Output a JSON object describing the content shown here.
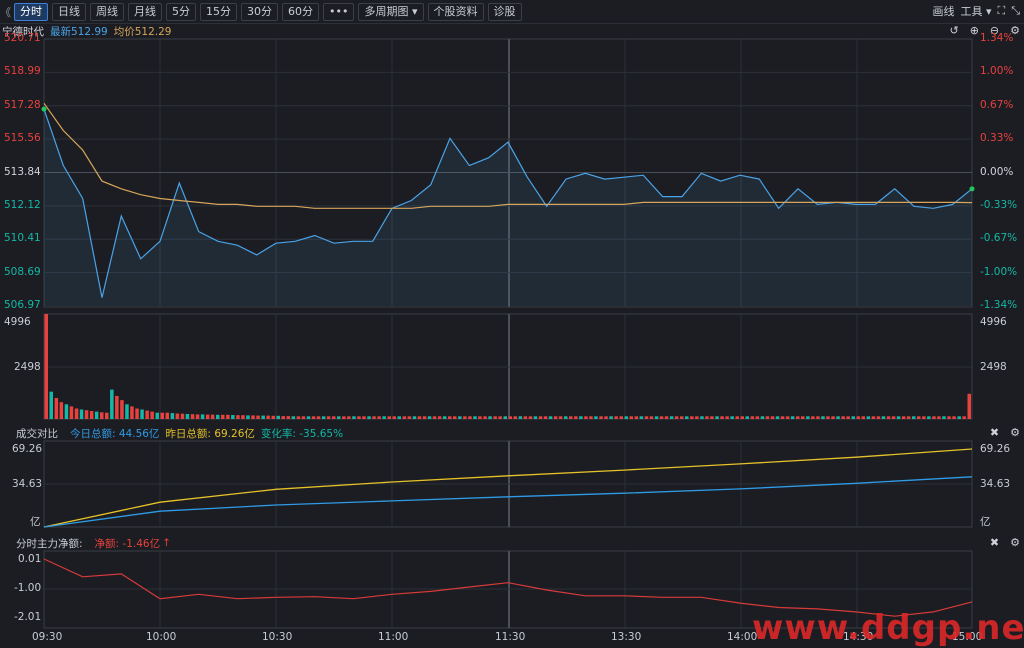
{
  "toolbar": {
    "left_arrow": "《",
    "tabs": [
      {
        "label": "分时",
        "active": true
      },
      {
        "label": "日线",
        "active": false
      },
      {
        "label": "周线",
        "active": false
      },
      {
        "label": "月线",
        "active": false
      },
      {
        "label": "5分",
        "active": false
      },
      {
        "label": "15分",
        "active": false
      },
      {
        "label": "30分",
        "active": false
      },
      {
        "label": "60分",
        "active": false
      }
    ],
    "more_label": "•••",
    "multi_period_label": "多周期图",
    "stock_info_label": "个股资料",
    "diagnose_label": "诊股",
    "draw_label": "画线",
    "tools_label": "工具"
  },
  "price_panel": {
    "stock_name": "宁德时代",
    "latest_label": "最新512.99",
    "avg_label": "均价512.29",
    "y_left": [
      "520.71",
      "518.99",
      "517.28",
      "515.56",
      "513.84",
      "512.12",
      "510.41",
      "508.69",
      "506.97"
    ],
    "y_right": [
      "1.34%",
      "1.00%",
      "0.67%",
      "0.33%",
      "0.00%",
      "-0.33%",
      "-0.67%",
      "-1.00%",
      "-1.34%"
    ]
  },
  "volume_panel": {
    "y_left": [
      "4996",
      "2498"
    ],
    "y_right": [
      "4996",
      "2498"
    ]
  },
  "compare_panel": {
    "title": "成交对比",
    "today_label": "今日总额: 44.56亿",
    "yesterday_label": "昨日总额: 69.26亿",
    "change_label": "变化率: -35.65%",
    "y_left": [
      "69.26",
      "34.63",
      "亿"
    ],
    "y_right": [
      "69.26",
      "34.63",
      "亿"
    ]
  },
  "flow_panel": {
    "title": "分时主力净额:",
    "net_label": "净额: -1.46亿",
    "y_left": [
      "0.01",
      "-1.00",
      "-2.01"
    ]
  },
  "x_labels": [
    "09:30",
    "10:00",
    "10:30",
    "11:00",
    "11:30",
    "13:30",
    "14:00",
    "14:30",
    "15:00"
  ],
  "watermark": "www.ddgp.net",
  "colors": {
    "price_line": "#4aa3e8",
    "avg_line": "#d6a55a",
    "up": "#e8413e",
    "down": "#14b8a6",
    "today_line": "#2f9be6",
    "yesterday_line": "#e6c229",
    "flow_line": "#d83a3a",
    "grid": "#2c3038",
    "accent": "#3d7fd6"
  },
  "chart_data": [
    {
      "type": "line",
      "name": "price",
      "x": [
        "09:30",
        "09:35",
        "09:40",
        "09:45",
        "09:50",
        "09:55",
        "10:00",
        "10:05",
        "10:10",
        "10:15",
        "10:20",
        "10:25",
        "10:30",
        "10:35",
        "10:40",
        "10:45",
        "10:50",
        "10:55",
        "11:00",
        "11:05",
        "11:10",
        "11:15",
        "11:20",
        "11:25",
        "11:30",
        "13:05",
        "13:10",
        "13:15",
        "13:20",
        "13:25",
        "13:30",
        "13:35",
        "13:40",
        "13:45",
        "13:50",
        "13:55",
        "14:00",
        "14:05",
        "14:10",
        "14:15",
        "14:20",
        "14:25",
        "14:30",
        "14:35",
        "14:40",
        "14:45",
        "14:50",
        "14:55",
        "15:00"
      ],
      "series": [
        {
          "values": [
            517.1,
            514.2,
            512.5,
            507.4,
            511.6,
            509.4,
            510.3,
            513.3,
            510.8,
            510.3,
            510.1,
            509.6,
            510.2,
            510.3,
            510.6,
            510.2,
            510.3,
            510.3,
            512.0,
            512.4,
            513.2,
            515.6,
            514.2,
            514.6,
            515.4,
            513.6,
            512.1,
            513.5,
            513.8,
            513.5,
            513.6,
            513.7,
            512.6,
            512.6,
            513.8,
            513.4,
            513.7,
            513.5,
            512.0,
            513.0,
            512.2,
            512.3,
            512.2,
            512.2,
            513.0,
            512.1,
            512.0,
            512.2,
            513.0
          ]
        },
        {
          "values": [
            517.4,
            516.0,
            515.0,
            513.4,
            513.0,
            512.7,
            512.5,
            512.4,
            512.3,
            512.2,
            512.2,
            512.1,
            512.1,
            512.1,
            512.0,
            512.0,
            512.0,
            512.0,
            512.0,
            512.0,
            512.1,
            512.1,
            512.1,
            512.1,
            512.2,
            512.2,
            512.2,
            512.2,
            512.2,
            512.2,
            512.2,
            512.3,
            512.3,
            512.3,
            512.3,
            512.3,
            512.3,
            512.3,
            512.3,
            512.3,
            512.3,
            512.3,
            512.3,
            512.3,
            512.3,
            512.3,
            512.3,
            512.3,
            512.29
          ]
        }
      ],
      "ylim": [
        506.97,
        520.71
      ]
    },
    {
      "type": "bar",
      "name": "volume",
      "values": [
        4996,
        1300,
        1000,
        800,
        700,
        600,
        500,
        450,
        420,
        380,
        350,
        320,
        300,
        1400,
        1100,
        900,
        700,
        600,
        500,
        450,
        400,
        350,
        300,
        300,
        300,
        280,
        260,
        250,
        240,
        230,
        220,
        220,
        210,
        210,
        200,
        200,
        200,
        190,
        180,
        180,
        170,
        170,
        160,
        160,
        160,
        150,
        150,
        140,
        140,
        130,
        130,
        130,
        130,
        130,
        130,
        130,
        130,
        130,
        130,
        130,
        130,
        130,
        130,
        130,
        130,
        130,
        130,
        130,
        130,
        130,
        130,
        130,
        130,
        130,
        130,
        130,
        130,
        130,
        130,
        130,
        130,
        130,
        130,
        130,
        130,
        130,
        130,
        130,
        130,
        130,
        130,
        130,
        130,
        130,
        130,
        130,
        130,
        130,
        130,
        130,
        130,
        130,
        130,
        130,
        130,
        130,
        130,
        130,
        130,
        130,
        130,
        130,
        130,
        130,
        130,
        130,
        130,
        130,
        130,
        130,
        130,
        130,
        130,
        130,
        130,
        130,
        130,
        130,
        130,
        130,
        130,
        130,
        130,
        130,
        130,
        130,
        130,
        130,
        130,
        130,
        130,
        130,
        130,
        130,
        130,
        130,
        130,
        130,
        130,
        130,
        130,
        130,
        130,
        130,
        130,
        130,
        130,
        130,
        130,
        130,
        130,
        130,
        130,
        130,
        130,
        130,
        130,
        130,
        130,
        130,
        130,
        130,
        130,
        130,
        130,
        130,
        130,
        130,
        130,
        130,
        130,
        130,
        130,
        1200
      ],
      "ylim": [
        0,
        4996
      ]
    },
    {
      "type": "line",
      "name": "compare",
      "x": [
        "09:30",
        "10:00",
        "10:30",
        "11:00",
        "11:30",
        "13:30",
        "14:00",
        "14:30",
        "15:00"
      ],
      "series": [
        {
          "values": [
            0,
            14.0,
            19.5,
            23.2,
            26.8,
            30.0,
            33.8,
            38.8,
            44.56
          ]
        },
        {
          "values": [
            0,
            22.0,
            33.5,
            40.0,
            45.5,
            50.5,
            56.0,
            62.0,
            69.26
          ]
        }
      ],
      "ylim": [
        0,
        69.26
      ]
    },
    {
      "type": "line",
      "name": "main_net_flow",
      "x": [
        "09:30",
        "09:40",
        "09:50",
        "10:00",
        "10:10",
        "10:20",
        "10:30",
        "10:40",
        "10:50",
        "11:00",
        "11:10",
        "11:20",
        "11:30",
        "13:10",
        "13:20",
        "13:30",
        "13:40",
        "13:50",
        "14:00",
        "14:10",
        "14:20",
        "14:30",
        "14:40",
        "14:50",
        "15:00"
      ],
      "series": [
        {
          "values": [
            0.01,
            -0.6,
            -0.5,
            -1.35,
            -1.2,
            -1.35,
            -1.3,
            -1.28,
            -1.35,
            -1.2,
            -1.1,
            -0.95,
            -0.8,
            -1.05,
            -1.25,
            -1.25,
            -1.3,
            -1.3,
            -1.5,
            -1.65,
            -1.7,
            -1.8,
            -1.95,
            -1.8,
            -1.46
          ]
        }
      ],
      "ylim": [
        -2.01,
        0.01
      ]
    }
  ]
}
